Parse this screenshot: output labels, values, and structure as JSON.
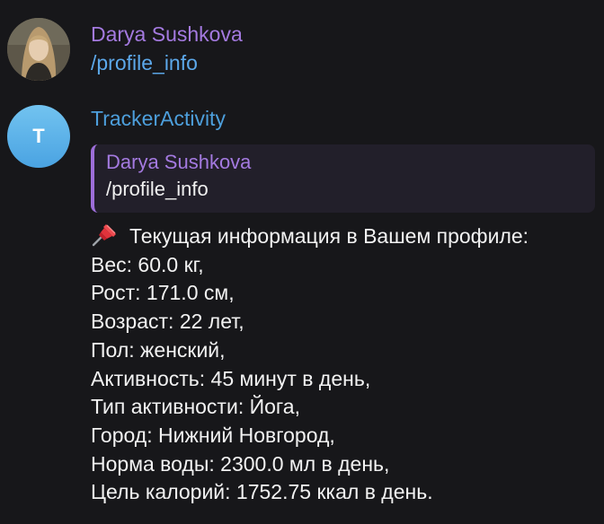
{
  "messages": {
    "user": {
      "sender": "Darya Sushkova",
      "text": "/profile_info"
    },
    "bot": {
      "sender": "TrackerActivity",
      "avatar_letter": "T",
      "reply": {
        "sender": "Darya Sushkova",
        "text": "/profile_info"
      },
      "header_icon": "pushpin-icon",
      "lines": [
        "Текущая информация в Вашем профиле:",
        "Вес: 60.0 кг,",
        "Рост: 171.0 см,",
        "Возраст: 22 лет,",
        "Пол: женский,",
        "Активность: 45 минут в день,",
        "Тип активности: Йога,",
        "Город: Нижний Новгород,",
        "Норма воды: 2300.0 мл в день,",
        "Цель калорий: 1752.75 ккал в день."
      ]
    }
  },
  "colors": {
    "background": "#17171a",
    "user_name": "#a47ae0",
    "bot_name": "#4d9fdc",
    "link": "#5ca8ea",
    "reply_bar": "#9d6ed9",
    "reply_bg": "#221f2a",
    "text": "#f2f2f2"
  }
}
